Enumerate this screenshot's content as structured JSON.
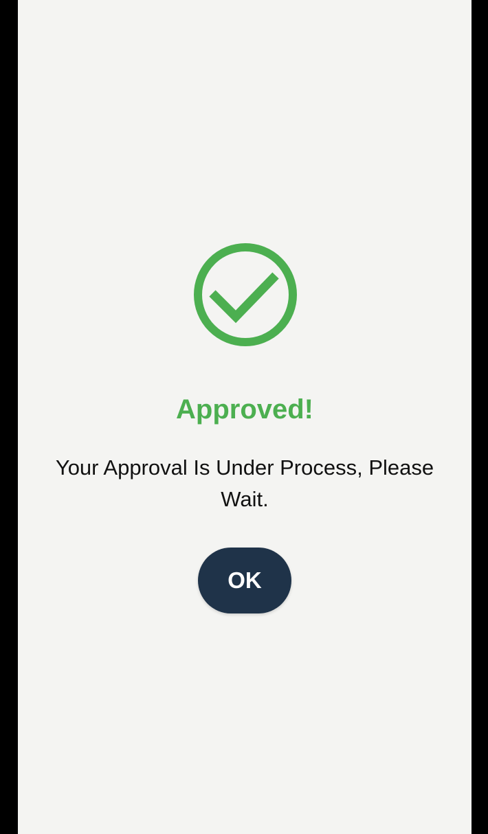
{
  "dialog": {
    "icon": "check-circle-icon",
    "title": "Approved!",
    "message": "Your Approval Is Under Process, Please Wait.",
    "ok_label": "OK"
  },
  "colors": {
    "success": "#4caf50",
    "button_bg": "#1f3349",
    "screen_bg": "#f4f4f2"
  }
}
